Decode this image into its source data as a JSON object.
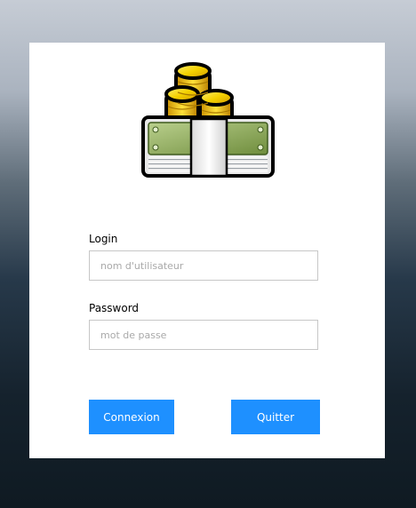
{
  "login_form": {
    "login_label": "Login",
    "login_placeholder": "nom d'utilisateur",
    "login_value": "",
    "password_label": "Password",
    "password_placeholder": "mot de passe",
    "password_value": "",
    "connect_label": "Connexion",
    "quit_label": "Quitter"
  },
  "icons": {
    "logo": "money-stack-icon"
  },
  "colors": {
    "button": "#1e90ff",
    "card": "#ffffff"
  }
}
